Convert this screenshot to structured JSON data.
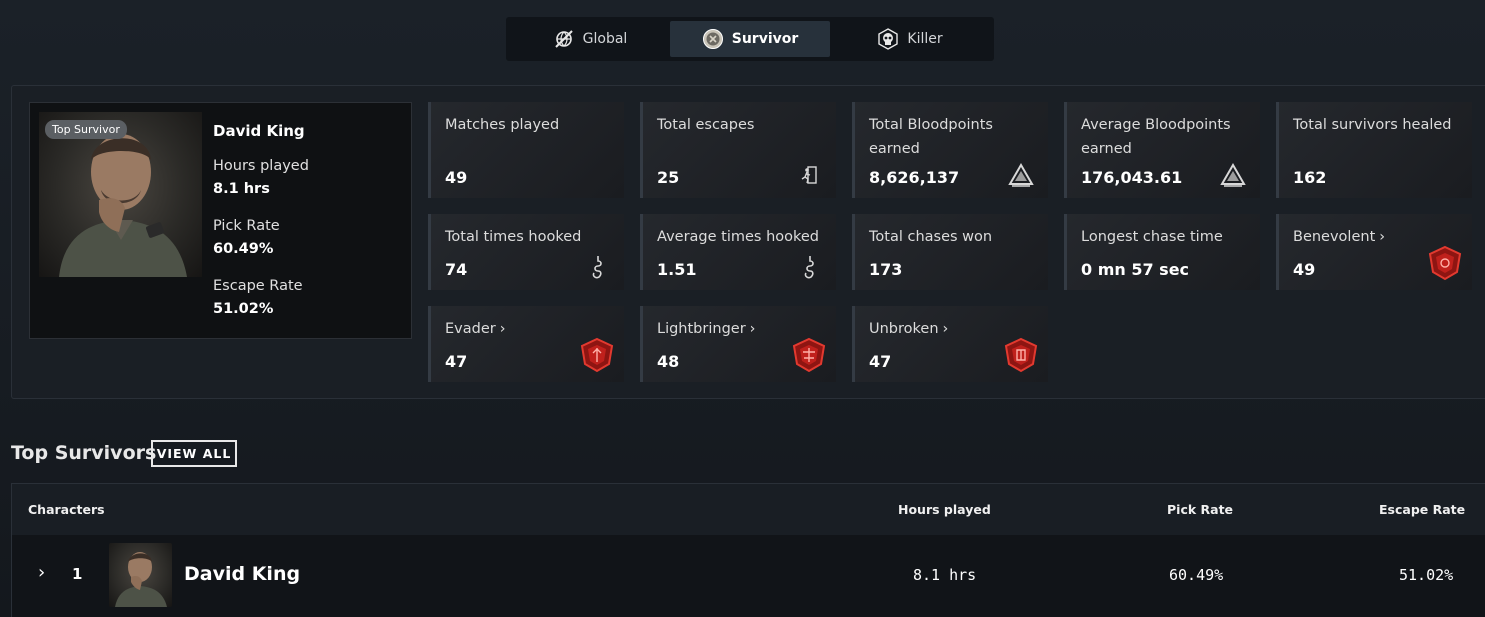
{
  "tabs": [
    {
      "label": "Global",
      "icon": "globe-tools-icon"
    },
    {
      "label": "Survivor",
      "icon": "survivor-emblem-icon",
      "active": true
    },
    {
      "label": "Killer",
      "icon": "skull-icon"
    }
  ],
  "profile": {
    "badge": "Top Survivor",
    "name": "David King",
    "hours_label": "Hours played",
    "hours_value": "8.1 hrs",
    "pick_label": "Pick Rate",
    "pick_value": "60.49%",
    "escape_label": "Escape Rate",
    "escape_value": "51.02%"
  },
  "stats": {
    "matches": {
      "label": "Matches played",
      "value": "49"
    },
    "escapes": {
      "label": "Total escapes",
      "value": "25"
    },
    "bloodpoints": {
      "label": "Total Bloodpoints earned",
      "value": "8,626,137"
    },
    "avg_bloodpoints": {
      "label": "Average Bloodpoints earned",
      "value": "176,043.61"
    },
    "healed": {
      "label": "Total survivors healed",
      "value": "162"
    },
    "hooked": {
      "label": "Total times hooked",
      "value": "74"
    },
    "avg_hooked": {
      "label": "Average times hooked",
      "value": "1.51"
    },
    "chases": {
      "label": "Total chases won",
      "value": "173"
    },
    "longest_chase": {
      "label": "Longest chase time",
      "value": "0 mn 57 sec"
    },
    "benevolent": {
      "label": "Benevolent",
      "value": "49"
    },
    "evader": {
      "label": "Evader",
      "value": "47"
    },
    "lightbringer": {
      "label": "Lightbringer",
      "value": "48"
    },
    "unbroken": {
      "label": "Unbroken",
      "value": "47"
    }
  },
  "top_survivors": {
    "title": "Top Survivors",
    "view_all": "VIEW ALL",
    "columns": [
      "Characters",
      "Hours played",
      "Pick Rate",
      "Escape Rate"
    ],
    "rows": [
      {
        "rank": "1",
        "name": "David King",
        "hours": "8.1 hrs",
        "pick_rate": "60.49%",
        "escape_rate": "51.02%"
      }
    ]
  },
  "colors": {
    "background": "#171c22",
    "card": "#222529",
    "accent_red": "#c0201c",
    "active_tab": "#27313b"
  }
}
